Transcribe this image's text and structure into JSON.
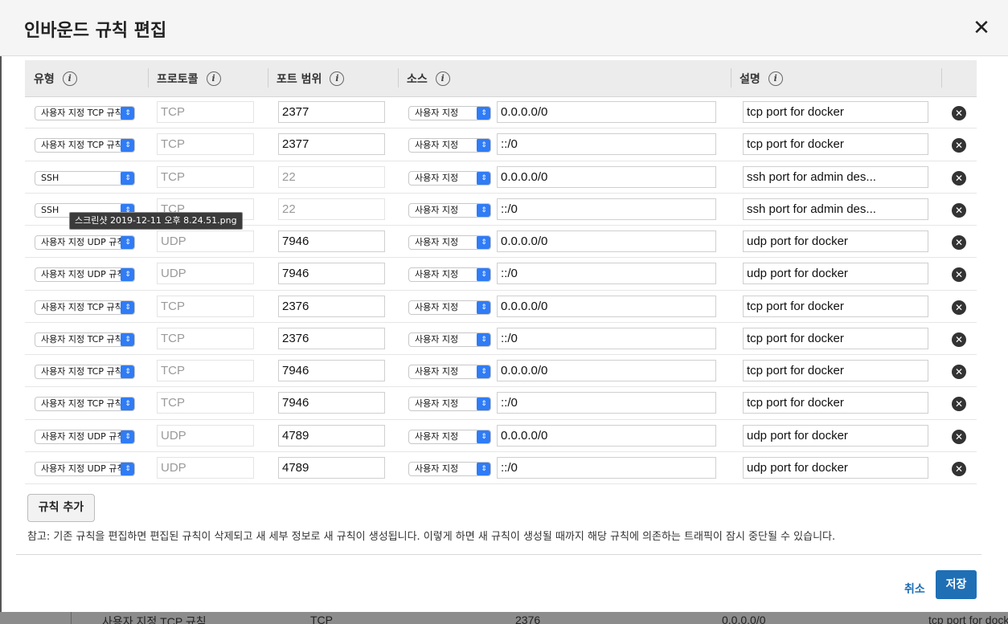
{
  "dialog": {
    "title": "인바운드 규칙 편집",
    "close_glyph": "✕"
  },
  "columns": [
    {
      "label": "유형",
      "info": "i"
    },
    {
      "label": "프로토콜",
      "info": "i"
    },
    {
      "label": "포트 범위",
      "info": "i"
    },
    {
      "label": "소스",
      "info": "i"
    },
    {
      "label": "설명",
      "info": "i"
    }
  ],
  "rules": [
    {
      "type": "사용자 지정 TCP 규칙",
      "protocol": "TCP",
      "port": "2377",
      "source_type": "사용자 지정",
      "cidr": "0.0.0.0/0",
      "description": "tcp port for docker"
    },
    {
      "type": "사용자 지정 TCP 규칙",
      "protocol": "TCP",
      "port": "2377",
      "source_type": "사용자 지정",
      "cidr": "::/0",
      "description": "tcp port for docker"
    },
    {
      "type": "SSH",
      "protocol": "TCP",
      "port": "22",
      "source_type": "사용자 지정",
      "cidr": "0.0.0.0/0",
      "description": "ssh port for admin des..."
    },
    {
      "type": "SSH",
      "protocol": "TCP",
      "port": "22",
      "source_type": "사용자 지정",
      "cidr": "::/0",
      "description": "ssh port for admin des..."
    },
    {
      "type": "사용자 지정 UDP 규칙",
      "protocol": "UDP",
      "port": "7946",
      "source_type": "사용자 지정",
      "cidr": "0.0.0.0/0",
      "description": "udp port for docker"
    },
    {
      "type": "사용자 지정 UDP 규칙",
      "protocol": "UDP",
      "port": "7946",
      "source_type": "사용자 지정",
      "cidr": "::/0",
      "description": "udp port for docker"
    },
    {
      "type": "사용자 지정 TCP 규칙",
      "protocol": "TCP",
      "port": "2376",
      "source_type": "사용자 지정",
      "cidr": "0.0.0.0/0",
      "description": "tcp port for docker"
    },
    {
      "type": "사용자 지정 TCP 규칙",
      "protocol": "TCP",
      "port": "2376",
      "source_type": "사용자 지정",
      "cidr": "::/0",
      "description": "tcp port for docker"
    },
    {
      "type": "사용자 지정 TCP 규칙",
      "protocol": "TCP",
      "port": "7946",
      "source_type": "사용자 지정",
      "cidr": "0.0.0.0/0",
      "description": "tcp port for docker"
    },
    {
      "type": "사용자 지정 TCP 규칙",
      "protocol": "TCP",
      "port": "7946",
      "source_type": "사용자 지정",
      "cidr": "::/0",
      "description": "tcp port for docker"
    },
    {
      "type": "사용자 지정 UDP 규칙",
      "protocol": "UDP",
      "port": "4789",
      "source_type": "사용자 지정",
      "cidr": "0.0.0.0/0",
      "description": "udp port for docker"
    },
    {
      "type": "사용자 지정 UDP 규칙",
      "protocol": "UDP",
      "port": "4789",
      "source_type": "사용자 지정",
      "cidr": "::/0",
      "description": "udp port for docker"
    }
  ],
  "tooltip": "스크린샷 2019-12-11 오후 8.24.51.png",
  "add_rule_label": "규칙 추가",
  "note": "참고: 기존 규칙을 편집하면 편집된 규칙이 삭제되고 새 세부 정보로 새 규칙이 생성됩니다. 이렇게 하면 새 규칙이 생성될 때까지 해당 규칙에 의존하는 트래픽이 잠시 중단될 수 있습니다.",
  "footer": {
    "cancel_label": "취소",
    "save_label": "저장"
  },
  "background_row": {
    "type": "사용자 지정 TCP 규칙",
    "protocol": "TCP",
    "port": "2376",
    "cidr": "0.0.0.0/0",
    "description": "tcp port for docker"
  },
  "icons": {
    "select_arrow": "select-arrow-icon",
    "delete": "remove-circle-icon",
    "info": "info-icon"
  },
  "colors": {
    "accent": "#1f6fb5",
    "select_arrow": "#2f7cf6"
  }
}
